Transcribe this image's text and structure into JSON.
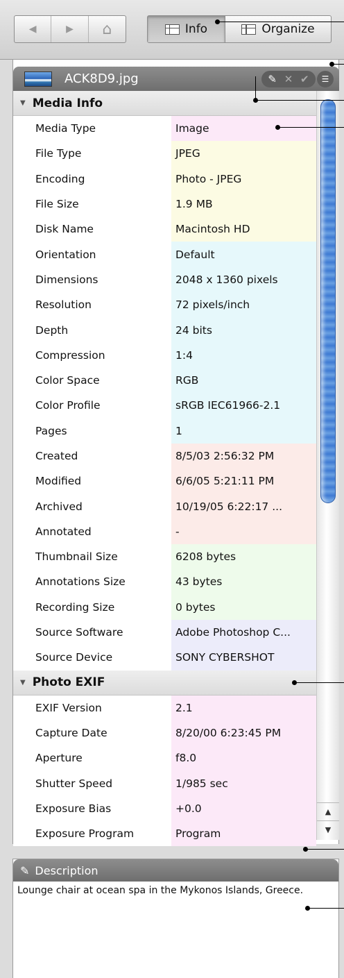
{
  "toolbar": {
    "nav": [
      {
        "name": "back-button",
        "icon": "back-arrow-icon",
        "glyph": "◀"
      },
      {
        "name": "forward-button",
        "icon": "forward-arrow-icon",
        "glyph": "▶"
      },
      {
        "name": "home-button",
        "icon": "home-icon",
        "glyph": "⌂"
      }
    ],
    "info_label": "Info",
    "organize_label": "Organize"
  },
  "file": {
    "name": "ACK8D9.jpg",
    "actions": {
      "edit": "✎",
      "cancel": "✕",
      "confirm": "✔",
      "list": "☰"
    }
  },
  "sections": [
    {
      "title": "Media Info",
      "rows": [
        {
          "label": "Media Type",
          "value": "Image",
          "color": "pink"
        },
        {
          "label": "File Type",
          "value": "JPEG",
          "color": "yellow"
        },
        {
          "label": "Encoding",
          "value": "Photo - JPEG",
          "color": "yellow"
        },
        {
          "label": "File Size",
          "value": "1.9  MB",
          "color": "yellow"
        },
        {
          "label": "Disk Name",
          "value": "Macintosh HD",
          "color": "yellow"
        },
        {
          "label": "Orientation",
          "value": "Default",
          "color": "cyan"
        },
        {
          "label": "Dimensions",
          "value": "2048 x 1360 pixels",
          "color": "cyan"
        },
        {
          "label": "Resolution",
          "value": "72 pixels/inch",
          "color": "cyan"
        },
        {
          "label": "Depth",
          "value": "24 bits",
          "color": "cyan"
        },
        {
          "label": "Compression",
          "value": "1:4",
          "color": "cyan"
        },
        {
          "label": "Color Space",
          "value": "RGB",
          "color": "cyan"
        },
        {
          "label": "Color Profile",
          "value": "sRGB IEC61966-2.1",
          "color": "cyan"
        },
        {
          "label": "Pages",
          "value": "1",
          "color": "cyan"
        },
        {
          "label": "Created",
          "value": "8/5/03 2:56:32 PM",
          "color": "peach"
        },
        {
          "label": "Modified",
          "value": "6/6/05 5:21:11 PM",
          "color": "peach"
        },
        {
          "label": "Archived",
          "value": "10/19/05 6:22:17 ...",
          "color": "peach"
        },
        {
          "label": "Annotated",
          "value": "-",
          "color": "peach"
        },
        {
          "label": "Thumbnail Size",
          "value": "6208 bytes",
          "color": "green"
        },
        {
          "label": "Annotations Size",
          "value": "43 bytes",
          "color": "green"
        },
        {
          "label": "Recording Size",
          "value": "0 bytes",
          "color": "green"
        },
        {
          "label": "Source Software",
          "value": "Adobe Photoshop C...",
          "color": "lav"
        },
        {
          "label": "Source Device",
          "value": "SONY CYBERSHOT",
          "color": "lav"
        }
      ]
    },
    {
      "title": "Photo EXIF",
      "rows": [
        {
          "label": "EXIF Version",
          "value": "2.1",
          "color": "pink"
        },
        {
          "label": "Capture Date",
          "value": "8/20/00 6:23:45 PM",
          "color": "pink"
        },
        {
          "label": "Aperture",
          "value": "f8.0",
          "color": "pink"
        },
        {
          "label": "Shutter Speed",
          "value": "1/985 sec",
          "color": "pink"
        },
        {
          "label": "Exposure Bias",
          "value": "+0.0",
          "color": "pink"
        },
        {
          "label": "Exposure Program",
          "value": "Program",
          "color": "pink"
        }
      ]
    }
  ],
  "scrollbar": {
    "up_glyph": "▲",
    "down_glyph": "▼"
  },
  "description": {
    "title": "Description",
    "icon": "✎",
    "text": "Lounge chair at ocean spa in the Mykonos Islands, Greece."
  }
}
